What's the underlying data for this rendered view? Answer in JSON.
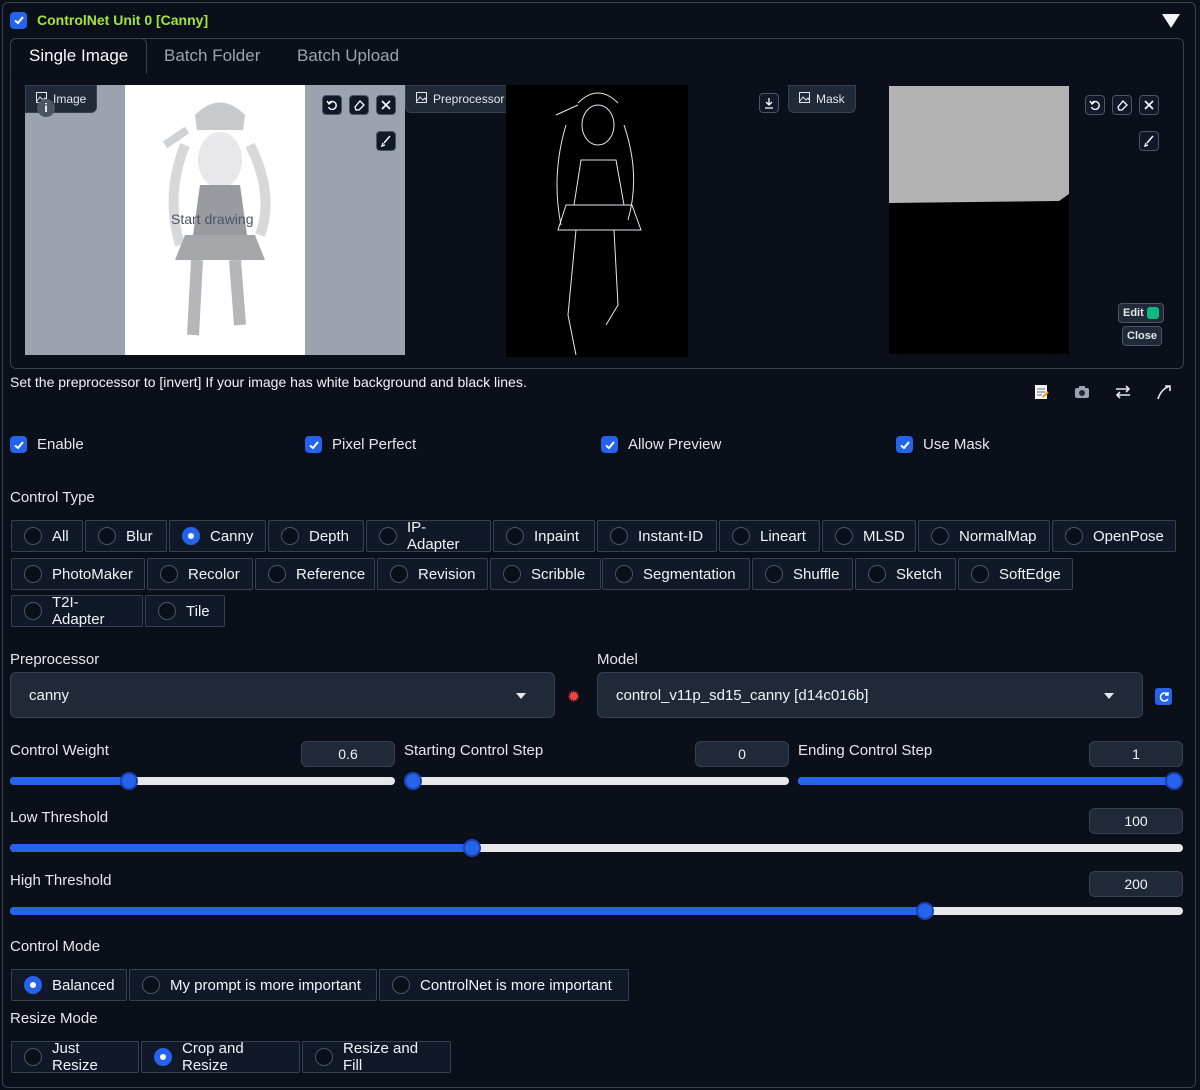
{
  "unit": {
    "title": "ControlNet Unit 0  [Canny]",
    "enabled": true
  },
  "tabs": [
    "Single Image",
    "Batch Folder",
    "Batch Upload"
  ],
  "image_panel": {
    "label": "Image",
    "overlay_text": "Start drawing"
  },
  "preview_panel": {
    "label": "Preprocessor Preview"
  },
  "mask_panel": {
    "label": "Mask",
    "edit_label": "Edit",
    "close_label": "Close"
  },
  "hint": "Set the preprocessor to [invert] If your image has white background and black lines.",
  "options": {
    "enable": "Enable",
    "pixel_perfect": "Pixel Perfect",
    "allow_preview": "Allow Preview",
    "use_mask": "Use Mask"
  },
  "control_type": {
    "label": "Control Type",
    "items": [
      "All",
      "Blur",
      "Canny",
      "Depth",
      "IP-Adapter",
      "Inpaint",
      "Instant-ID",
      "Lineart",
      "MLSD",
      "NormalMap",
      "OpenPose",
      "PhotoMaker",
      "Recolor",
      "Reference",
      "Revision",
      "Scribble",
      "Segmentation",
      "Shuffle",
      "Sketch",
      "SoftEdge",
      "T2I-Adapter",
      "Tile"
    ],
    "selected": "Canny"
  },
  "preprocessor": {
    "label": "Preprocessor",
    "value": "canny"
  },
  "model": {
    "label": "Model",
    "value": "control_v11p_sd15_canny [d14c016b]"
  },
  "sliders": {
    "control_weight": {
      "label": "Control Weight",
      "value": "0.6",
      "fraction": 0.3
    },
    "starting_step": {
      "label": "Starting Control Step",
      "value": "0",
      "fraction": 0.0
    },
    "ending_step": {
      "label": "Ending Control Step",
      "value": "1",
      "fraction": 1.0
    },
    "low_threshold": {
      "label": "Low Threshold",
      "value": "100",
      "fraction": 0.392
    },
    "high_threshold": {
      "label": "High Threshold",
      "value": "200",
      "fraction": 0.784
    }
  },
  "control_mode": {
    "label": "Control Mode",
    "items": [
      "Balanced",
      "My prompt is more important",
      "ControlNet is more important"
    ],
    "selected": "Balanced"
  },
  "resize_mode": {
    "label": "Resize Mode",
    "items": [
      "Just Resize",
      "Crop and Resize",
      "Resize and Fill"
    ],
    "selected": "Crop and Resize"
  },
  "colors": {
    "accent": "#2563eb",
    "title": "#a3e635",
    "background": "#0b0f19"
  }
}
